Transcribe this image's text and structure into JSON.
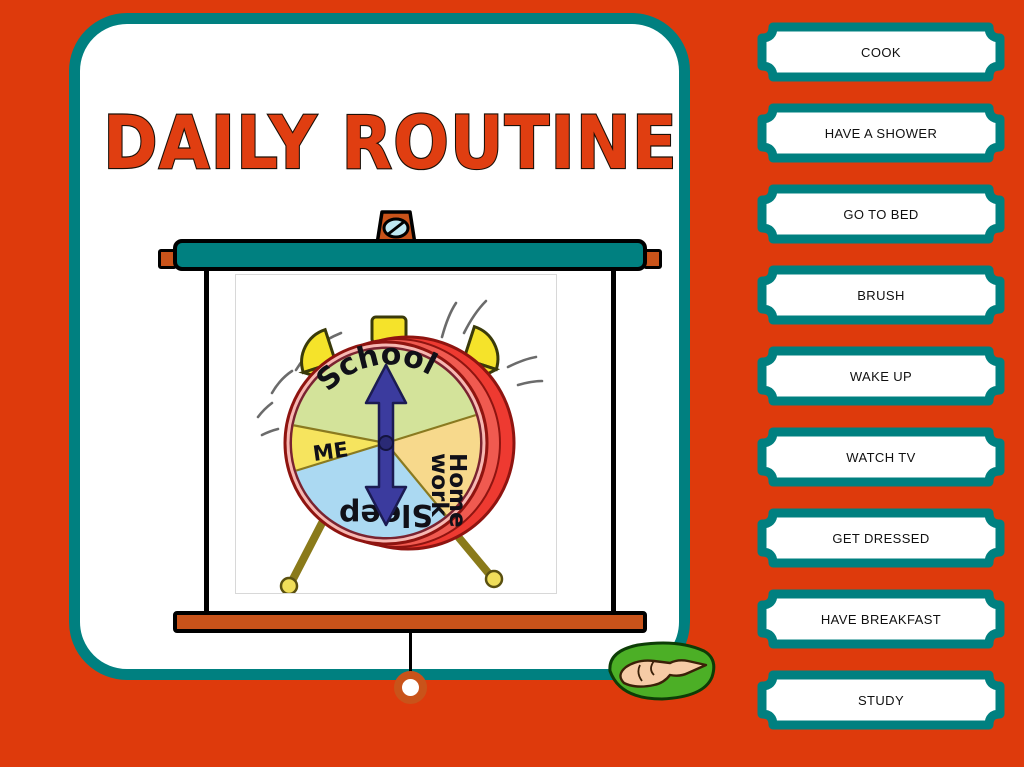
{
  "page": {
    "background_color": "#DE3A0C",
    "accent_teal": "#008080",
    "accent_orange": "#C9531A",
    "title": "DAILY ROUTINE"
  },
  "card": {
    "border_color": "#008080",
    "fill_color": "#FFFFFF"
  },
  "projector": {
    "top_bar_color": "#008080",
    "bottom_bar_color": "#C9531A",
    "cap_color": "#C9531A",
    "mount_icon": "mount-knob-icon",
    "cord_ring_color": "#C9531A",
    "hand_icon": "pointing-hand-icon",
    "hand_badge_color": "#4CAF26"
  },
  "picture": {
    "alt": "cartoon alarm clock with daily routine pie chart",
    "clock_body_color": "#E8322C",
    "bell_color": "#F5E32A",
    "segments": [
      {
        "label": "School",
        "color": "#CFE08A"
      },
      {
        "label": "Homework",
        "color": "#F7D98C"
      },
      {
        "label": "Sleep",
        "color": "#A8D8F0"
      },
      {
        "label": "ME",
        "color": "#F5E32A"
      }
    ],
    "hand_color": "#3B3B9E"
  },
  "labels": [
    {
      "id": "cook",
      "text": "COOK"
    },
    {
      "id": "have-a-shower",
      "text": "HAVE A SHOWER"
    },
    {
      "id": "go-to-bed",
      "text": "GO TO BED"
    },
    {
      "id": "brush",
      "text": "BRUSH"
    },
    {
      "id": "wake-up",
      "text": "WAKE UP"
    },
    {
      "id": "watch-tv",
      "text": "WATCH TV"
    },
    {
      "id": "get-dressed",
      "text": "GET DRESSED"
    },
    {
      "id": "have-breakfast",
      "text": "HAVE BREAKFAST"
    },
    {
      "id": "study",
      "text": "STUDY"
    }
  ]
}
